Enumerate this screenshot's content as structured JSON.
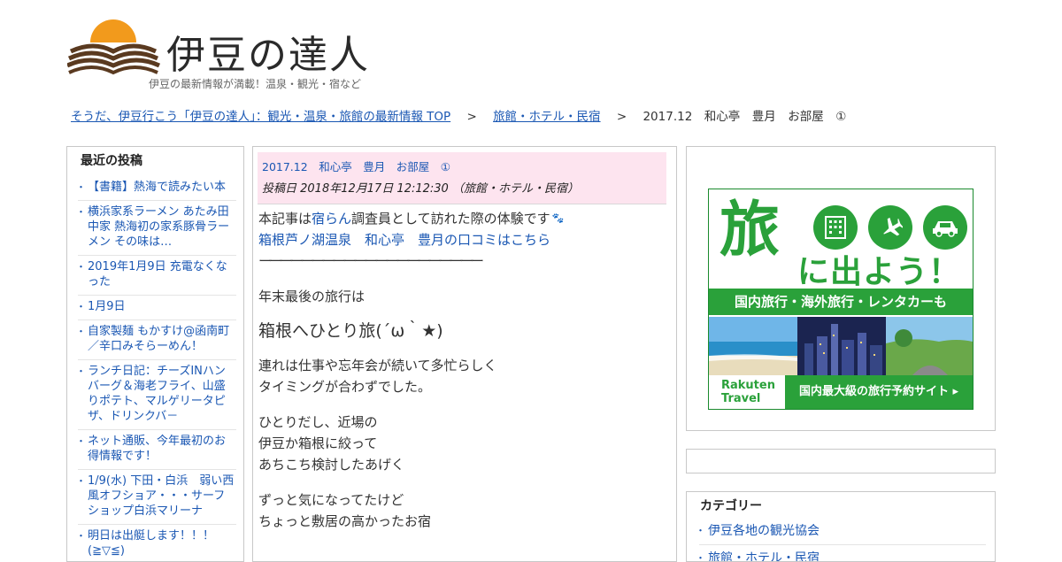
{
  "site": {
    "title": "伊豆の達人",
    "tagline": "伊豆の最新情報が満載！温泉・観光・宿など"
  },
  "breadcrumb": {
    "home": "そうだ、伊豆行こう「伊豆の達人」：観光・温泉・旅館の最新情報 TOP",
    "sep1": ">",
    "category": "旅館・ホテル・民宿",
    "sep2": ">",
    "current": "2017.12　和心亭　豊月　お部屋　①"
  },
  "recent_posts": {
    "heading": "最近の投稿",
    "items": [
      "【書籍】熱海で読みたい本",
      "横浜家系ラーメン あたみ田中家 熱海初の家系豚骨ラーメン その味は…",
      "2019年1月9日 充電なくなった",
      "1月9日",
      "自家製麺 もかすけ@函南町／辛口みそらーめん！",
      "ランチ日記：チーズINハンバーグ＆海老フライ、山盛りポテト、マルゲリータピザ、ドリンクバ－",
      "ネット通販、今年最初のお得情報です！",
      "1/9(水) 下田・白浜　弱い西風オフショア・・・サーフショップ白浜マリーナ",
      "明日は出艇します！！！(≧▽≦)"
    ]
  },
  "article": {
    "title": "2017.12　和心亭　豊月　お部屋　①",
    "meta": "投稿日 2018年12月17日 12:12:30 （旅館・ホテル・民宿）",
    "intro_prefix": "本記事は",
    "intro_link": "宿らん",
    "intro_suffix": "調査員として訪れた際の体験です",
    "review_link": "箱根芦ノ湖温泉　和心亭　豊月の口コミはこちら",
    "rule": "ーーーーーーーーーーーーーーーーーーーーー",
    "p1": "年末最後の旅行は",
    "p2": "箱根へひとり旅(´ω｀★)",
    "p3a": "連れは仕事や忘年会が続いて多忙らしく",
    "p3b": "タイミングが合わずでした。",
    "p4a": "ひとりだし、近場の",
    "p4b": "伊豆か箱根に絞って",
    "p4c": "あちこち検討したあげく",
    "p5a": "ずっと気になってたけど",
    "p5b": "ちょっと敷居の高かったお宿"
  },
  "banner": {
    "big_char": "旅",
    "headline": "に出よう！",
    "tagline": "国内旅行・海外旅行・レンタカーも",
    "brand_line1": "Rakuten",
    "brand_line2": "Travel",
    "cta": "国内最大級の旅行予約サイト",
    "icons": [
      "hotel-icon",
      "airplane-icon",
      "car-icon"
    ],
    "accent_color": "#2aa13a"
  },
  "categories": {
    "heading": "カテゴリー",
    "items": [
      "伊豆各地の観光協会",
      "旅館・ホテル・民宿"
    ]
  },
  "colors": {
    "link": "#1a57b3",
    "article_header_bg": "#fde4ef",
    "sun": "#f29a1c",
    "border": "#c8c8c8"
  }
}
